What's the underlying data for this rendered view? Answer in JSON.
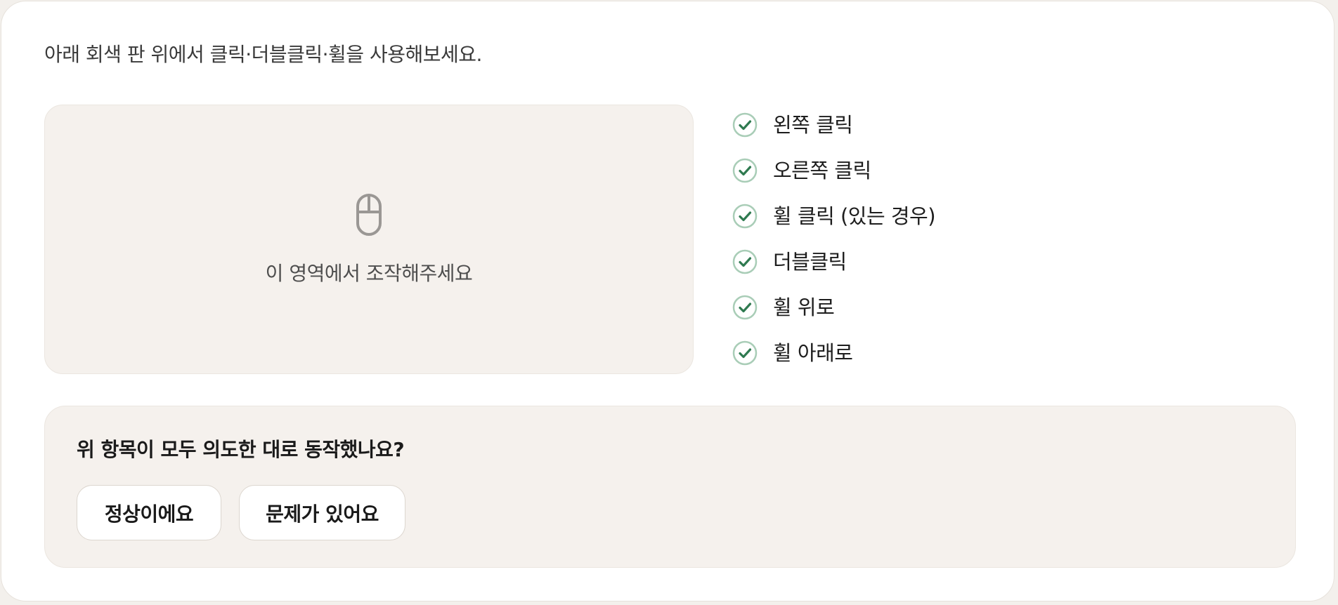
{
  "instruction": "아래 회색 판 위에서 클릭·더블클릭·휠을 사용해보세요.",
  "test_area": {
    "icon": "mouse-icon",
    "label": "이 영역에서 조작해주세요"
  },
  "checklist": {
    "icon": "check-circle-icon",
    "items": [
      {
        "label": "왼쪽 클릭",
        "checked": true
      },
      {
        "label": "오른쪽 클릭",
        "checked": true
      },
      {
        "label": "휠 클릭 (있는 경우)",
        "checked": true
      },
      {
        "label": "더블클릭",
        "checked": true
      },
      {
        "label": "휠 위로",
        "checked": true
      },
      {
        "label": "휠 아래로",
        "checked": true
      }
    ]
  },
  "feedback": {
    "question": "위 항목이 모두 의도한 대로 동작했나요?",
    "ok_label": "정상이에요",
    "problem_label": "문제가 있어요"
  },
  "colors": {
    "page_bg": "#f3f0ec",
    "card_bg": "#ffffff",
    "panel_bg": "#f5f1ed",
    "check_green": "#2f7a50",
    "check_ring": "#a9cdb7",
    "mouse_gray": "#9a9794"
  }
}
